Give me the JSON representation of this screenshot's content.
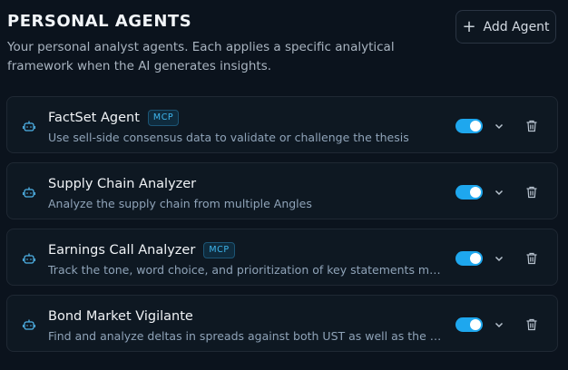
{
  "header": {
    "title": "PERSONAL AGENTS",
    "description": "Your personal analyst agents. Each applies a specific analytical framework when the AI generates insights.",
    "add_button_label": "Add Agent"
  },
  "colors": {
    "accent": "#1ea7ee",
    "background": "#0b131d",
    "card": "#0e1822",
    "badge_text": "#3fb6ee"
  },
  "agents": [
    {
      "name": "FactSet Agent",
      "badge": "MCP",
      "description": "Use sell-side consensus data to validate or challenge the thesis",
      "enabled": true
    },
    {
      "name": "Supply Chain Analyzer",
      "badge": "",
      "description": "Analyze the supply chain from multiple Angles",
      "enabled": true
    },
    {
      "name": "Earnings Call Analyzer",
      "badge": "MCP",
      "description": "Track the tone, word choice, and prioritization of key statements made by t...",
      "enabled": true
    },
    {
      "name": "Bond Market Vigilante",
      "badge": "",
      "description": "Find and analyze deltas in spreads against both UST as well as the other to...",
      "enabled": true
    }
  ],
  "icons": {
    "agent": "bot-icon",
    "expand": "chevron-down-icon",
    "delete": "trash-icon",
    "add": "plus-icon"
  }
}
